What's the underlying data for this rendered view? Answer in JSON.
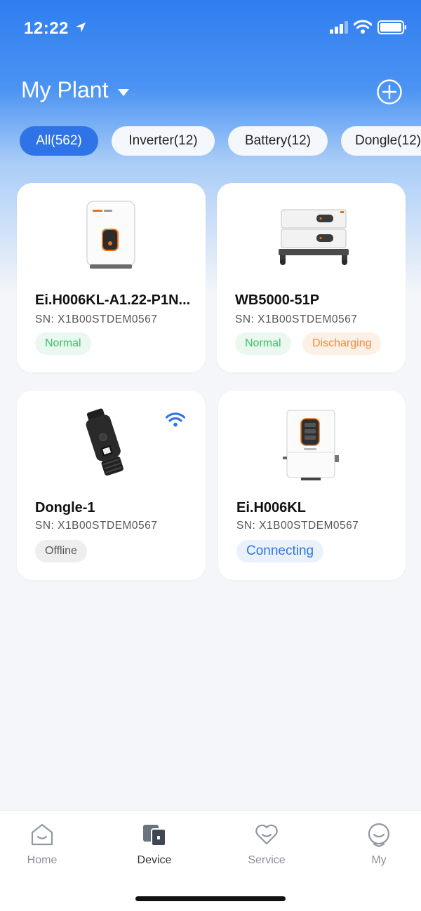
{
  "status_bar": {
    "time": "12:22"
  },
  "header": {
    "title": "My Plant"
  },
  "filters": [
    {
      "label": "All(562)",
      "active": true
    },
    {
      "label": "Inverter(12)",
      "active": false
    },
    {
      "label": "Battery(12)",
      "active": false
    },
    {
      "label": "Dongle(12)",
      "active": false
    }
  ],
  "devices": [
    {
      "name": "Ei.H006KL-A1.22-P1N...",
      "sn": "SN:  X1B00STDEM0567",
      "badges": [
        "Normal"
      ]
    },
    {
      "name": "WB5000-51P",
      "sn": "SN:  X1B00STDEM0567",
      "badges": [
        "Normal",
        "Discharging"
      ]
    },
    {
      "name": "Dongle-1",
      "sn": "SN:  X1B00STDEM0567",
      "badges": [
        "Offline"
      ]
    },
    {
      "name": "Ei.H006KL",
      "sn": "SN:  X1B00STDEM0567",
      "badges": [
        "Connecting"
      ]
    }
  ],
  "tabs": [
    {
      "label": "Home",
      "icon": "home-icon",
      "active": false
    },
    {
      "label": "Device",
      "icon": "device-icon",
      "active": true
    },
    {
      "label": "Service",
      "icon": "heart-icon",
      "active": false
    },
    {
      "label": "My",
      "icon": "profile-icon",
      "active": false
    }
  ],
  "colors": {
    "primary": "#2e74e6",
    "normal": "#3cbf6a",
    "discharging": "#f08a3c",
    "offline": "#555555",
    "accent_orange": "#e8731e"
  }
}
